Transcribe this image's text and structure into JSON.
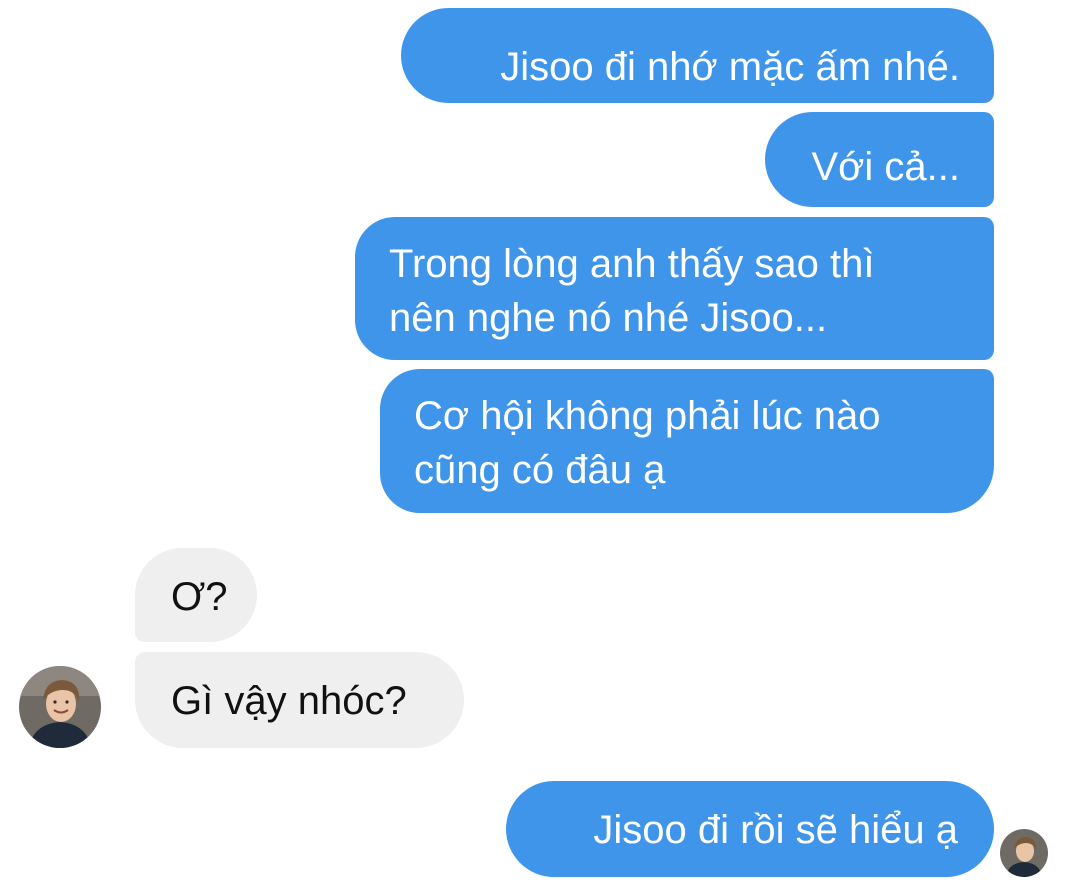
{
  "conversation": {
    "messages": [
      {
        "direction": "outgoing",
        "text": "Jisoo đi nhớ mặc ấm nhé."
      },
      {
        "direction": "outgoing",
        "text": "Với cả..."
      },
      {
        "direction": "outgoing",
        "text": "Trong lòng anh thấy sao thì\nnên nghe nó nhé Jisoo..."
      },
      {
        "direction": "outgoing",
        "text": "Cơ hội không phải lúc nào\ncũng có đâu ạ"
      },
      {
        "direction": "incoming",
        "text": "Ơ?"
      },
      {
        "direction": "incoming",
        "text": "Gì vậy nhóc?"
      },
      {
        "direction": "outgoing",
        "text": "Jisoo đi rồi sẽ hiểu ạ"
      }
    ],
    "contact_avatar_icon": "profile-photo-icon",
    "seen_avatar_icon": "read-receipt-avatar-icon"
  },
  "colors": {
    "outgoing_bubble": "#3f95ea",
    "incoming_bubble": "#efefef",
    "outgoing_text": "#ffffff",
    "incoming_text": "#111111",
    "background": "#ffffff"
  }
}
